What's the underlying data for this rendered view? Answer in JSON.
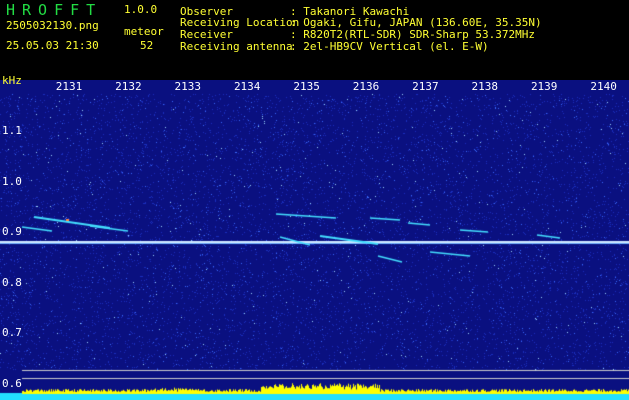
{
  "app": {
    "name": "HROFFT",
    "version": "1.0.0",
    "filename": "2505032130.png",
    "datetime": "25.05.03 21:30",
    "mode_label": "meteor",
    "meteor_count": "52"
  },
  "info": {
    "observer_label": "Observer",
    "observer_value": ": Takanori Kawachi",
    "location_label": "Receiving Location",
    "location_value": ": Ogaki, Gifu, JAPAN (136.60E, 35.35N)",
    "receiver_label": "Receiver",
    "receiver_value": ": R820T2(RTL-SDR) SDR-Sharp 53.372MHz",
    "antenna_label": "Receiving antenna",
    "antenna_value": ": 2el-HB9CV Vertical (el. E-W)"
  },
  "axis": {
    "unit": "kHz",
    "time_ticks": [
      "2131",
      "2132",
      "2133",
      "2134",
      "2135",
      "2136",
      "2137",
      "2138",
      "2139",
      "2140"
    ],
    "freq_ticks": [
      "1.1",
      "1.0",
      "0.9",
      "0.8",
      "0.7",
      "0.6"
    ]
  },
  "colors": {
    "background": "#0a1080",
    "carrier": "#cfe8ff",
    "echo": "#44e0ff",
    "histogram": "#ffff00",
    "baseline": "#22e0ff"
  }
}
